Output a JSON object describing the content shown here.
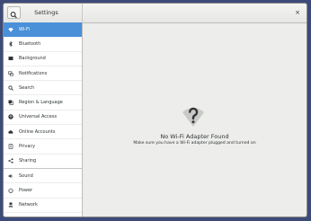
{
  "window": {
    "sidebar_title": "Settings",
    "close_glyph": "×"
  },
  "sidebar": {
    "items": [
      {
        "label": "Wi-Fi",
        "icon": "wifi-icon",
        "active": true
      },
      {
        "label": "Bluetooth",
        "icon": "bluetooth-icon"
      },
      {
        "label": "Background",
        "icon": "background-icon"
      },
      {
        "label": "Notifications",
        "icon": "notifications-icon"
      },
      {
        "label": "Search",
        "icon": "search-icon"
      },
      {
        "label": "Region & Language",
        "icon": "region-icon"
      },
      {
        "label": "Universal Access",
        "icon": "universal-access-icon"
      },
      {
        "label": "Online Accounts",
        "icon": "online-accounts-icon"
      },
      {
        "label": "Privacy",
        "icon": "privacy-icon"
      },
      {
        "label": "Sharing",
        "icon": "sharing-icon"
      },
      {
        "label": "Sound",
        "icon": "sound-icon"
      },
      {
        "label": "Power",
        "icon": "power-icon"
      },
      {
        "label": "Network",
        "icon": "network-icon"
      }
    ]
  },
  "main": {
    "title": "No Wi-Fi Adapter Found",
    "subtitle": "Make sure you have a Wi-Fi adapter plugged and turned on",
    "icon": "wifi-question-icon"
  },
  "colors": {
    "accent": "#4a90d9",
    "desktop": "#3d4b7a"
  }
}
